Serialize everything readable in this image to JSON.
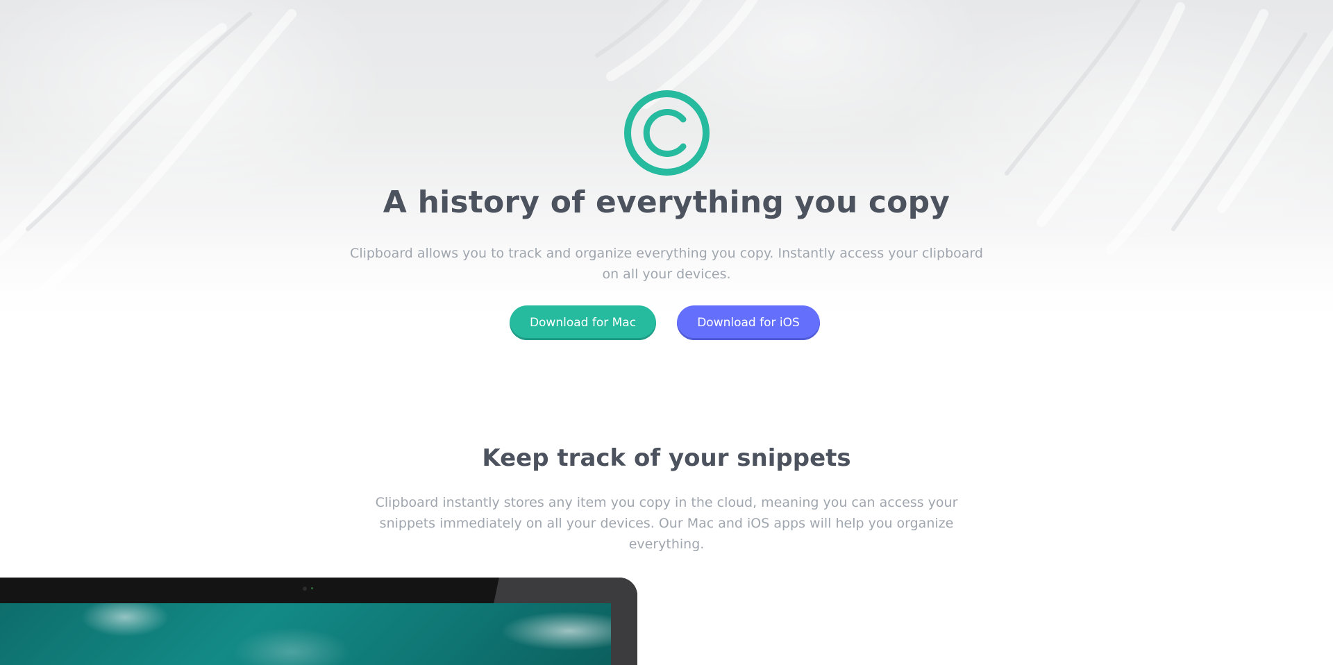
{
  "hero": {
    "logo_icon": "copyright-circle-icon",
    "title": "A history of everything you copy",
    "description": "Clipboard allows you to track and organize everything you copy. Instantly access your clipboard on all your devices.",
    "buttons": {
      "mac_label": "Download for Mac",
      "ios_label": "Download for iOS"
    }
  },
  "snippets_section": {
    "title": "Keep track of your snippets",
    "description": "Clipboard instantly stores any item you copy in the cloud, meaning you can access your snippets immediately on all your devices. Our Mac and iOS apps will help you organize everything."
  },
  "colors": {
    "accent_green": "#26ba9f",
    "accent_blue": "#6470fc",
    "heading": "#4c535e",
    "body_text": "#a0a6ae"
  }
}
